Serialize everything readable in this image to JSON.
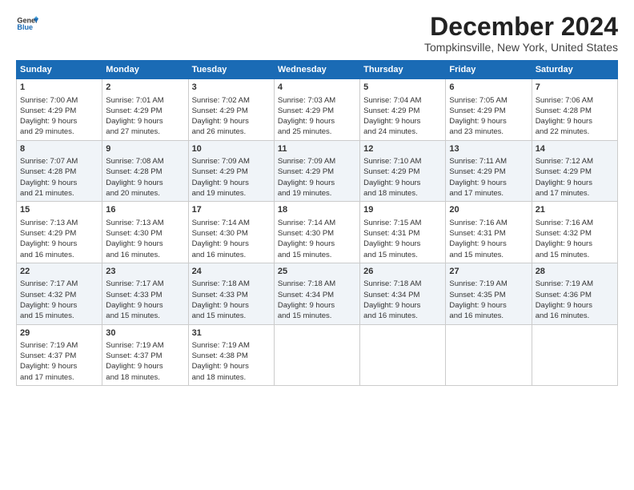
{
  "logo": {
    "line1": "General",
    "line2": "Blue"
  },
  "title": "December 2024",
  "subtitle": "Tompkinsville, New York, United States",
  "headers": [
    "Sunday",
    "Monday",
    "Tuesday",
    "Wednesday",
    "Thursday",
    "Friday",
    "Saturday"
  ],
  "weeks": [
    [
      {
        "day": "1",
        "info": "Sunrise: 7:00 AM\nSunset: 4:29 PM\nDaylight: 9 hours\nand 29 minutes."
      },
      {
        "day": "2",
        "info": "Sunrise: 7:01 AM\nSunset: 4:29 PM\nDaylight: 9 hours\nand 27 minutes."
      },
      {
        "day": "3",
        "info": "Sunrise: 7:02 AM\nSunset: 4:29 PM\nDaylight: 9 hours\nand 26 minutes."
      },
      {
        "day": "4",
        "info": "Sunrise: 7:03 AM\nSunset: 4:29 PM\nDaylight: 9 hours\nand 25 minutes."
      },
      {
        "day": "5",
        "info": "Sunrise: 7:04 AM\nSunset: 4:29 PM\nDaylight: 9 hours\nand 24 minutes."
      },
      {
        "day": "6",
        "info": "Sunrise: 7:05 AM\nSunset: 4:29 PM\nDaylight: 9 hours\nand 23 minutes."
      },
      {
        "day": "7",
        "info": "Sunrise: 7:06 AM\nSunset: 4:28 PM\nDaylight: 9 hours\nand 22 minutes."
      }
    ],
    [
      {
        "day": "8",
        "info": "Sunrise: 7:07 AM\nSunset: 4:28 PM\nDaylight: 9 hours\nand 21 minutes."
      },
      {
        "day": "9",
        "info": "Sunrise: 7:08 AM\nSunset: 4:28 PM\nDaylight: 9 hours\nand 20 minutes."
      },
      {
        "day": "10",
        "info": "Sunrise: 7:09 AM\nSunset: 4:29 PM\nDaylight: 9 hours\nand 19 minutes."
      },
      {
        "day": "11",
        "info": "Sunrise: 7:09 AM\nSunset: 4:29 PM\nDaylight: 9 hours\nand 19 minutes."
      },
      {
        "day": "12",
        "info": "Sunrise: 7:10 AM\nSunset: 4:29 PM\nDaylight: 9 hours\nand 18 minutes."
      },
      {
        "day": "13",
        "info": "Sunrise: 7:11 AM\nSunset: 4:29 PM\nDaylight: 9 hours\nand 17 minutes."
      },
      {
        "day": "14",
        "info": "Sunrise: 7:12 AM\nSunset: 4:29 PM\nDaylight: 9 hours\nand 17 minutes."
      }
    ],
    [
      {
        "day": "15",
        "info": "Sunrise: 7:13 AM\nSunset: 4:29 PM\nDaylight: 9 hours\nand 16 minutes."
      },
      {
        "day": "16",
        "info": "Sunrise: 7:13 AM\nSunset: 4:30 PM\nDaylight: 9 hours\nand 16 minutes."
      },
      {
        "day": "17",
        "info": "Sunrise: 7:14 AM\nSunset: 4:30 PM\nDaylight: 9 hours\nand 16 minutes."
      },
      {
        "day": "18",
        "info": "Sunrise: 7:14 AM\nSunset: 4:30 PM\nDaylight: 9 hours\nand 15 minutes."
      },
      {
        "day": "19",
        "info": "Sunrise: 7:15 AM\nSunset: 4:31 PM\nDaylight: 9 hours\nand 15 minutes."
      },
      {
        "day": "20",
        "info": "Sunrise: 7:16 AM\nSunset: 4:31 PM\nDaylight: 9 hours\nand 15 minutes."
      },
      {
        "day": "21",
        "info": "Sunrise: 7:16 AM\nSunset: 4:32 PM\nDaylight: 9 hours\nand 15 minutes."
      }
    ],
    [
      {
        "day": "22",
        "info": "Sunrise: 7:17 AM\nSunset: 4:32 PM\nDaylight: 9 hours\nand 15 minutes."
      },
      {
        "day": "23",
        "info": "Sunrise: 7:17 AM\nSunset: 4:33 PM\nDaylight: 9 hours\nand 15 minutes."
      },
      {
        "day": "24",
        "info": "Sunrise: 7:18 AM\nSunset: 4:33 PM\nDaylight: 9 hours\nand 15 minutes."
      },
      {
        "day": "25",
        "info": "Sunrise: 7:18 AM\nSunset: 4:34 PM\nDaylight: 9 hours\nand 15 minutes."
      },
      {
        "day": "26",
        "info": "Sunrise: 7:18 AM\nSunset: 4:34 PM\nDaylight: 9 hours\nand 16 minutes."
      },
      {
        "day": "27",
        "info": "Sunrise: 7:19 AM\nSunset: 4:35 PM\nDaylight: 9 hours\nand 16 minutes."
      },
      {
        "day": "28",
        "info": "Sunrise: 7:19 AM\nSunset: 4:36 PM\nDaylight: 9 hours\nand 16 minutes."
      }
    ],
    [
      {
        "day": "29",
        "info": "Sunrise: 7:19 AM\nSunset: 4:37 PM\nDaylight: 9 hours\nand 17 minutes."
      },
      {
        "day": "30",
        "info": "Sunrise: 7:19 AM\nSunset: 4:37 PM\nDaylight: 9 hours\nand 18 minutes."
      },
      {
        "day": "31",
        "info": "Sunrise: 7:19 AM\nSunset: 4:38 PM\nDaylight: 9 hours\nand 18 minutes."
      },
      {
        "day": "",
        "info": ""
      },
      {
        "day": "",
        "info": ""
      },
      {
        "day": "",
        "info": ""
      },
      {
        "day": "",
        "info": ""
      }
    ]
  ]
}
